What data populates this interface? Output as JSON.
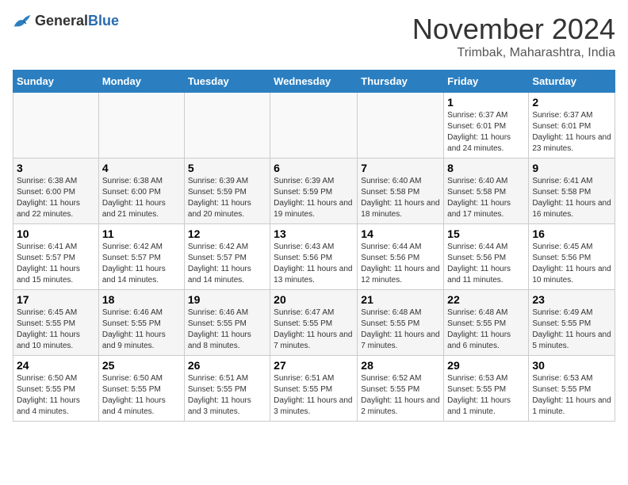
{
  "logo": {
    "general": "General",
    "blue": "Blue"
  },
  "header": {
    "month": "November 2024",
    "location": "Trimbak, Maharashtra, India"
  },
  "weekdays": [
    "Sunday",
    "Monday",
    "Tuesday",
    "Wednesday",
    "Thursday",
    "Friday",
    "Saturday"
  ],
  "weeks": [
    [
      {
        "day": "",
        "info": ""
      },
      {
        "day": "",
        "info": ""
      },
      {
        "day": "",
        "info": ""
      },
      {
        "day": "",
        "info": ""
      },
      {
        "day": "",
        "info": ""
      },
      {
        "day": "1",
        "info": "Sunrise: 6:37 AM\nSunset: 6:01 PM\nDaylight: 11 hours and 24 minutes."
      },
      {
        "day": "2",
        "info": "Sunrise: 6:37 AM\nSunset: 6:01 PM\nDaylight: 11 hours and 23 minutes."
      }
    ],
    [
      {
        "day": "3",
        "info": "Sunrise: 6:38 AM\nSunset: 6:00 PM\nDaylight: 11 hours and 22 minutes."
      },
      {
        "day": "4",
        "info": "Sunrise: 6:38 AM\nSunset: 6:00 PM\nDaylight: 11 hours and 21 minutes."
      },
      {
        "day": "5",
        "info": "Sunrise: 6:39 AM\nSunset: 5:59 PM\nDaylight: 11 hours and 20 minutes."
      },
      {
        "day": "6",
        "info": "Sunrise: 6:39 AM\nSunset: 5:59 PM\nDaylight: 11 hours and 19 minutes."
      },
      {
        "day": "7",
        "info": "Sunrise: 6:40 AM\nSunset: 5:58 PM\nDaylight: 11 hours and 18 minutes."
      },
      {
        "day": "8",
        "info": "Sunrise: 6:40 AM\nSunset: 5:58 PM\nDaylight: 11 hours and 17 minutes."
      },
      {
        "day": "9",
        "info": "Sunrise: 6:41 AM\nSunset: 5:58 PM\nDaylight: 11 hours and 16 minutes."
      }
    ],
    [
      {
        "day": "10",
        "info": "Sunrise: 6:41 AM\nSunset: 5:57 PM\nDaylight: 11 hours and 15 minutes."
      },
      {
        "day": "11",
        "info": "Sunrise: 6:42 AM\nSunset: 5:57 PM\nDaylight: 11 hours and 14 minutes."
      },
      {
        "day": "12",
        "info": "Sunrise: 6:42 AM\nSunset: 5:57 PM\nDaylight: 11 hours and 14 minutes."
      },
      {
        "day": "13",
        "info": "Sunrise: 6:43 AM\nSunset: 5:56 PM\nDaylight: 11 hours and 13 minutes."
      },
      {
        "day": "14",
        "info": "Sunrise: 6:44 AM\nSunset: 5:56 PM\nDaylight: 11 hours and 12 minutes."
      },
      {
        "day": "15",
        "info": "Sunrise: 6:44 AM\nSunset: 5:56 PM\nDaylight: 11 hours and 11 minutes."
      },
      {
        "day": "16",
        "info": "Sunrise: 6:45 AM\nSunset: 5:56 PM\nDaylight: 11 hours and 10 minutes."
      }
    ],
    [
      {
        "day": "17",
        "info": "Sunrise: 6:45 AM\nSunset: 5:55 PM\nDaylight: 11 hours and 10 minutes."
      },
      {
        "day": "18",
        "info": "Sunrise: 6:46 AM\nSunset: 5:55 PM\nDaylight: 11 hours and 9 minutes."
      },
      {
        "day": "19",
        "info": "Sunrise: 6:46 AM\nSunset: 5:55 PM\nDaylight: 11 hours and 8 minutes."
      },
      {
        "day": "20",
        "info": "Sunrise: 6:47 AM\nSunset: 5:55 PM\nDaylight: 11 hours and 7 minutes."
      },
      {
        "day": "21",
        "info": "Sunrise: 6:48 AM\nSunset: 5:55 PM\nDaylight: 11 hours and 7 minutes."
      },
      {
        "day": "22",
        "info": "Sunrise: 6:48 AM\nSunset: 5:55 PM\nDaylight: 11 hours and 6 minutes."
      },
      {
        "day": "23",
        "info": "Sunrise: 6:49 AM\nSunset: 5:55 PM\nDaylight: 11 hours and 5 minutes."
      }
    ],
    [
      {
        "day": "24",
        "info": "Sunrise: 6:50 AM\nSunset: 5:55 PM\nDaylight: 11 hours and 4 minutes."
      },
      {
        "day": "25",
        "info": "Sunrise: 6:50 AM\nSunset: 5:55 PM\nDaylight: 11 hours and 4 minutes."
      },
      {
        "day": "26",
        "info": "Sunrise: 6:51 AM\nSunset: 5:55 PM\nDaylight: 11 hours and 3 minutes."
      },
      {
        "day": "27",
        "info": "Sunrise: 6:51 AM\nSunset: 5:55 PM\nDaylight: 11 hours and 3 minutes."
      },
      {
        "day": "28",
        "info": "Sunrise: 6:52 AM\nSunset: 5:55 PM\nDaylight: 11 hours and 2 minutes."
      },
      {
        "day": "29",
        "info": "Sunrise: 6:53 AM\nSunset: 5:55 PM\nDaylight: 11 hours and 1 minute."
      },
      {
        "day": "30",
        "info": "Sunrise: 6:53 AM\nSunset: 5:55 PM\nDaylight: 11 hours and 1 minute."
      }
    ]
  ]
}
